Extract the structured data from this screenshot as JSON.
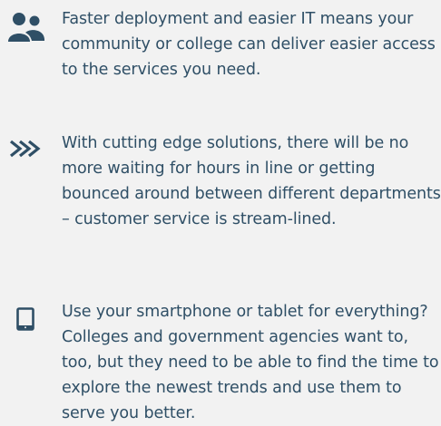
{
  "colors": {
    "background": "#f2f2f2",
    "text": "#2f4f66",
    "icon": "#2f4f66"
  },
  "features": [
    {
      "icon": "users-icon",
      "text": "Faster deployment and easier IT means your community or college can deliver easier access to the services you need."
    },
    {
      "icon": "triple-chevron-right-icon",
      "text": "With cutting edge solutions, there will be no more waiting for hours in line or getting bounced around between different departments – customer service is stream-lined."
    },
    {
      "icon": "tablet-icon",
      "text": "Use your smartphone or tablet for everything? Colleges and government agencies want to, too, but they need to be able to find the time to explore the newest trends and use them to serve you better."
    }
  ]
}
